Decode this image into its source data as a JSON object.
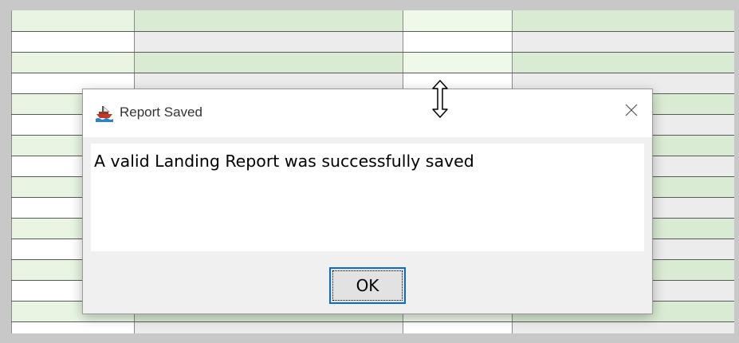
{
  "background_table": {
    "row_count": 16,
    "column_count": 4
  },
  "dialog": {
    "title": "Report Saved",
    "app_icon": "ship-icon",
    "close_icon": "close-icon",
    "message": "A valid Landing Report was successfully saved",
    "ok_label": "OK"
  },
  "cursor": {
    "icon": "resize-vertical-cursor-icon"
  },
  "colors": {
    "accent": "#0f6ac2",
    "row_green": "#d9ebd2",
    "row_gray": "#ececec",
    "dialog_bg": "#f0f0f0"
  }
}
